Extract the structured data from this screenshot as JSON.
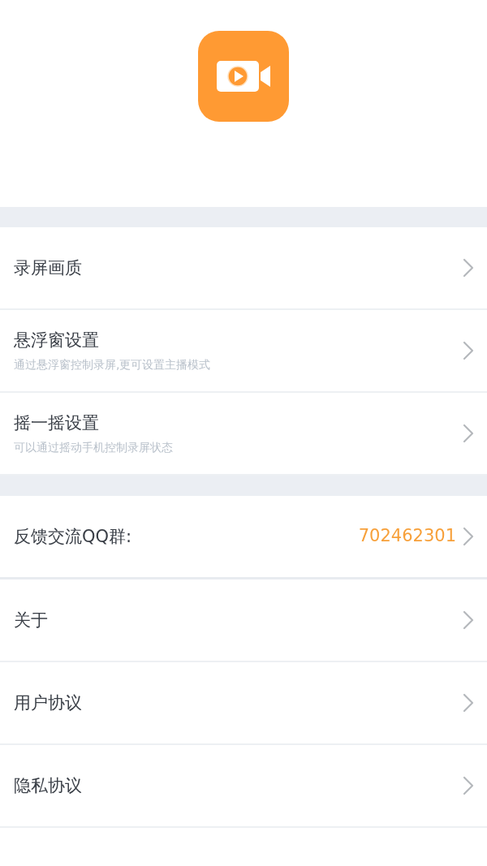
{
  "sections": [
    {
      "items": [
        {
          "title": "录屏画质"
        },
        {
          "title": "悬浮窗设置",
          "subtitle": "通过悬浮窗控制录屏,更可设置主播模式"
        },
        {
          "title": "摇一摇设置",
          "subtitle": "可以通过摇动手机控制录屏状态"
        }
      ]
    },
    {
      "items": [
        {
          "title": "反馈交流QQ群:",
          "value": "702462301"
        }
      ]
    },
    {
      "items": [
        {
          "title": "关于"
        },
        {
          "title": "用户协议"
        },
        {
          "title": "隐私协议"
        }
      ]
    }
  ]
}
